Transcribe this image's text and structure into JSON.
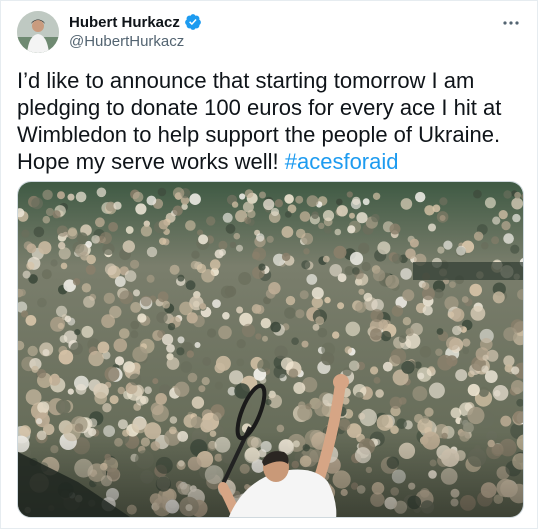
{
  "author": {
    "display_name": "Hubert Hurkacz",
    "handle": "@HubertHurkacz",
    "verified": true,
    "avatar_icon": "player-avatar-icon"
  },
  "menu": {
    "icon": "more-options-icon"
  },
  "tweet": {
    "text": "I’d like to announce that starting tomorrow I am pledging to donate 100 euros for every ace I hit at Wimbledon to help support the people of Ukraine. Hope my serve works well! ",
    "hashtag": "#acesforaid"
  },
  "media": {
    "icon": "photo-tennis-serve",
    "colors": {
      "grass": "#2f5b35",
      "crowd_base": "#6d7560",
      "accent": "#1d9bf0"
    }
  }
}
